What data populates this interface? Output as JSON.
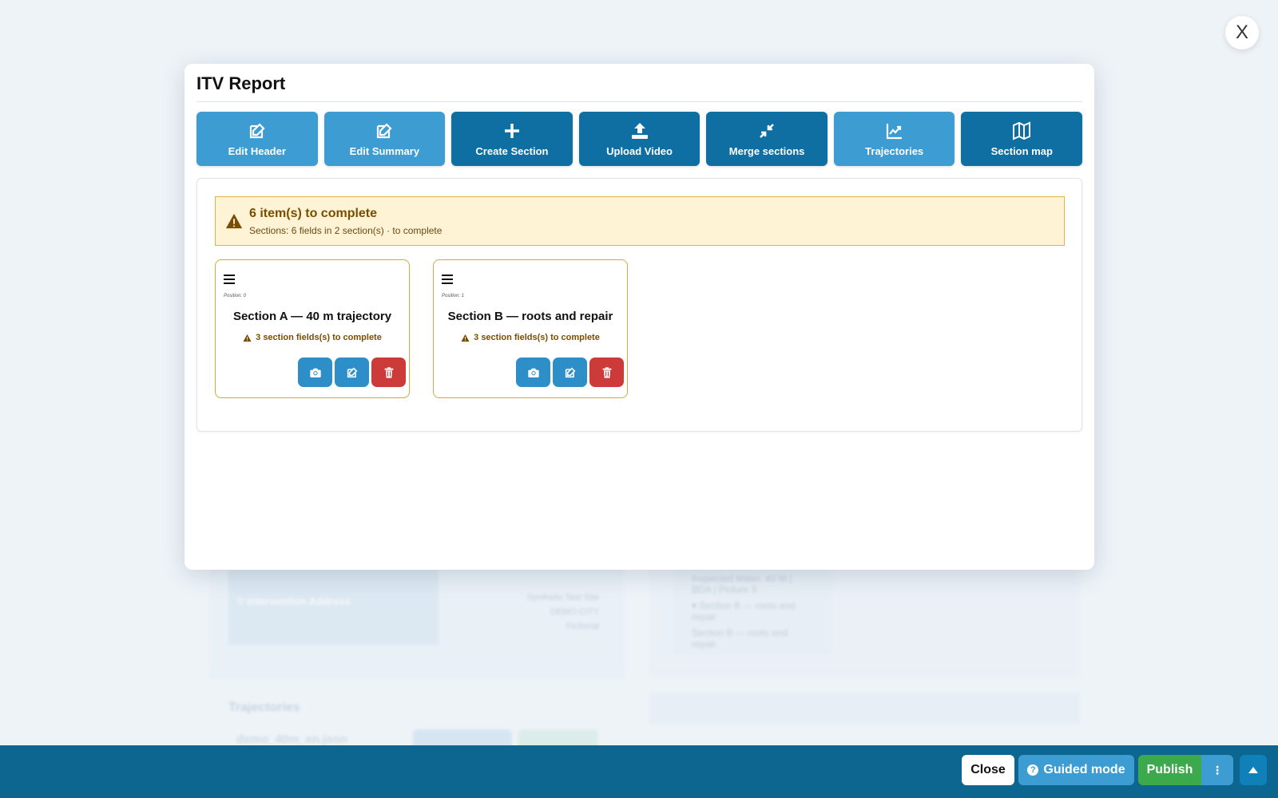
{
  "background": {
    "intervention_address_label": "Intervention Address",
    "address_lines": [
      "Synthetic Test Site",
      "DEMO CITY",
      "Fictional"
    ],
    "tree_items": [
      "Inspected Mater. 40 M | BDA | Picture 3",
      "▾ Section B — roots and repair",
      "Section B — roots and repair"
    ],
    "trajectories_title": "Trajectories",
    "trajectory_file": "demo_40m_en.json"
  },
  "close_x": "X",
  "modal": {
    "title": "ITV Report",
    "toolbar": [
      {
        "label": "Edit Header",
        "icon": "edit-icon"
      },
      {
        "label": "Edit Summary",
        "icon": "edit-icon"
      },
      {
        "label": "Create Section",
        "icon": "plus-icon"
      },
      {
        "label": "Upload Video",
        "icon": "upload-icon"
      },
      {
        "label": "Merge sections",
        "icon": "compress-icon"
      },
      {
        "label": "Trajectories",
        "icon": "line-chart-icon"
      },
      {
        "label": "Section map",
        "icon": "map-icon"
      }
    ],
    "alert": {
      "title": "6 item(s) to complete",
      "subtitle": "Sections: 6 fields in 2 section(s) · to complete"
    },
    "sections": [
      {
        "position": "Position: 0",
        "title": "Section A — 40 m trajectory",
        "warning": "3 section fields(s) to complete"
      },
      {
        "position": "Position: 1",
        "title": "Section B — roots and repair",
        "warning": "3 section fields(s) to complete"
      }
    ]
  },
  "bottombar": {
    "close": "Close",
    "guided_mode": "Guided mode",
    "guided_icon": "?",
    "publish": "Publish",
    "more": "⋮"
  },
  "colors": {
    "primary_light": "#3d9dd3",
    "primary_dark": "#0f6fa2",
    "warning_bg": "#fff3d6",
    "warning_border": "#d9b44a",
    "danger": "#cc3a3a",
    "success": "#3caa4c",
    "bottombar": "#0c6690"
  }
}
